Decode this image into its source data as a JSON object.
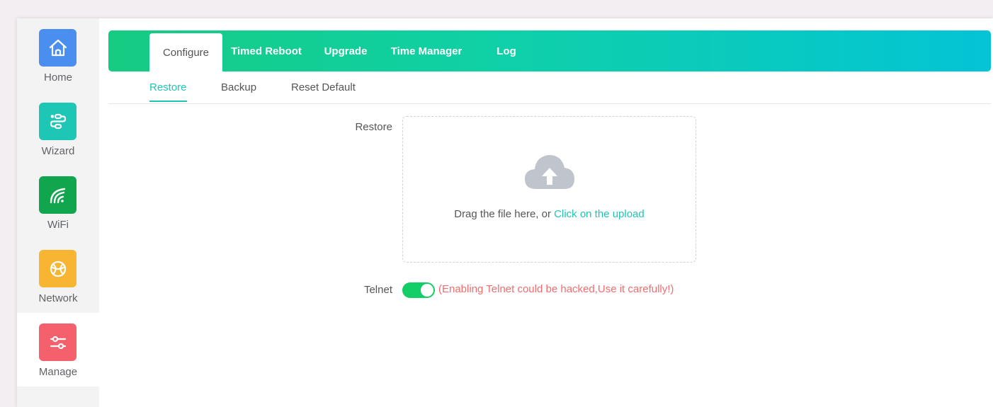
{
  "sidebar": {
    "items": [
      {
        "label": "Home",
        "icon": "home-icon",
        "color": "#4a8ff0"
      },
      {
        "label": "Wizard",
        "icon": "route-icon",
        "color": "#1ec6b6"
      },
      {
        "label": "WiFi",
        "icon": "wifi-icon",
        "color": "#11a64e"
      },
      {
        "label": "Network",
        "icon": "globe-icon",
        "color": "#f7b531"
      },
      {
        "label": "Manage",
        "icon": "sliders-icon",
        "color": "#f4606c"
      }
    ],
    "active": "Manage"
  },
  "topnav": {
    "tabs": [
      "Configure",
      "Timed Reboot",
      "Upgrade",
      "Time Manager",
      "Log"
    ],
    "active": "Configure"
  },
  "subnav": {
    "tabs": [
      "Restore",
      "Backup",
      "Reset Default"
    ],
    "active": "Restore"
  },
  "form": {
    "restore_label": "Restore",
    "upload": {
      "text": "Drag the file here, or",
      "link": "Click on the upload",
      "icon": "cloud-upload-icon"
    },
    "telnet_label": "Telnet",
    "telnet_enabled": true,
    "telnet_warning": "(Enabling Telnet could be hacked,Use it carefully!)"
  },
  "colors": {
    "accent": "#1ec6b6",
    "toggle_on": "#13ce66",
    "warning": "#f56c6c"
  }
}
